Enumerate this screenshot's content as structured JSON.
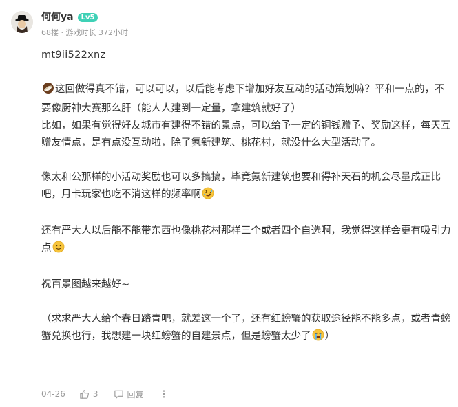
{
  "author": {
    "username": "何何ya",
    "level": "Lv5",
    "floor": "68楼",
    "separator": "·",
    "playtime": "游戏时长 372小时"
  },
  "post": {
    "code": "mt9ii522xnz",
    "paragraphs": [
      "这回做得真不错，可以可以，以后能考虑下增加好友互动的活动策划嘛？平和一点的，不要像厨神大赛那么肝（能人人建到一定量，拿建筑就好了）",
      "比如，如果有觉得好友城市有建得不错的景点，可以给予一定的铜钱赠予、奖励这样，每天互赠友情点，是有点没互动啦，除了氪新建筑、桃花村，就没什么大型活动了。",
      "像太和公那样的小活动奖励也可以多搞搞，毕竟氪新建筑也要和得补天石的机会尽量成正比吧，月卡玩家也吃不消这样的频率啊",
      "还有严大人以后能不能带东西也像桃花村那样三个或者四个自选啊，我觉得这样会更有吸引力点",
      "祝百景图越来越好~",
      "（求求严大人给个春日踏青吧，就差这一个了，还有红螃蟹的获取途径能不能多点，或者青螃蟹兑换也行，我想建一块红螃蟹的自建景点，但是螃蟹太少了",
      "）"
    ],
    "emojis": [
      "coconut-emoji",
      "rofl-emoji",
      "smile-emoji",
      "sob-emoji"
    ]
  },
  "footer": {
    "date": "04-26",
    "like_count": "3",
    "reply_label": "回复"
  },
  "colors": {
    "level_badge": "#3fd1b6",
    "text": "#333333",
    "meta": "#999999"
  }
}
